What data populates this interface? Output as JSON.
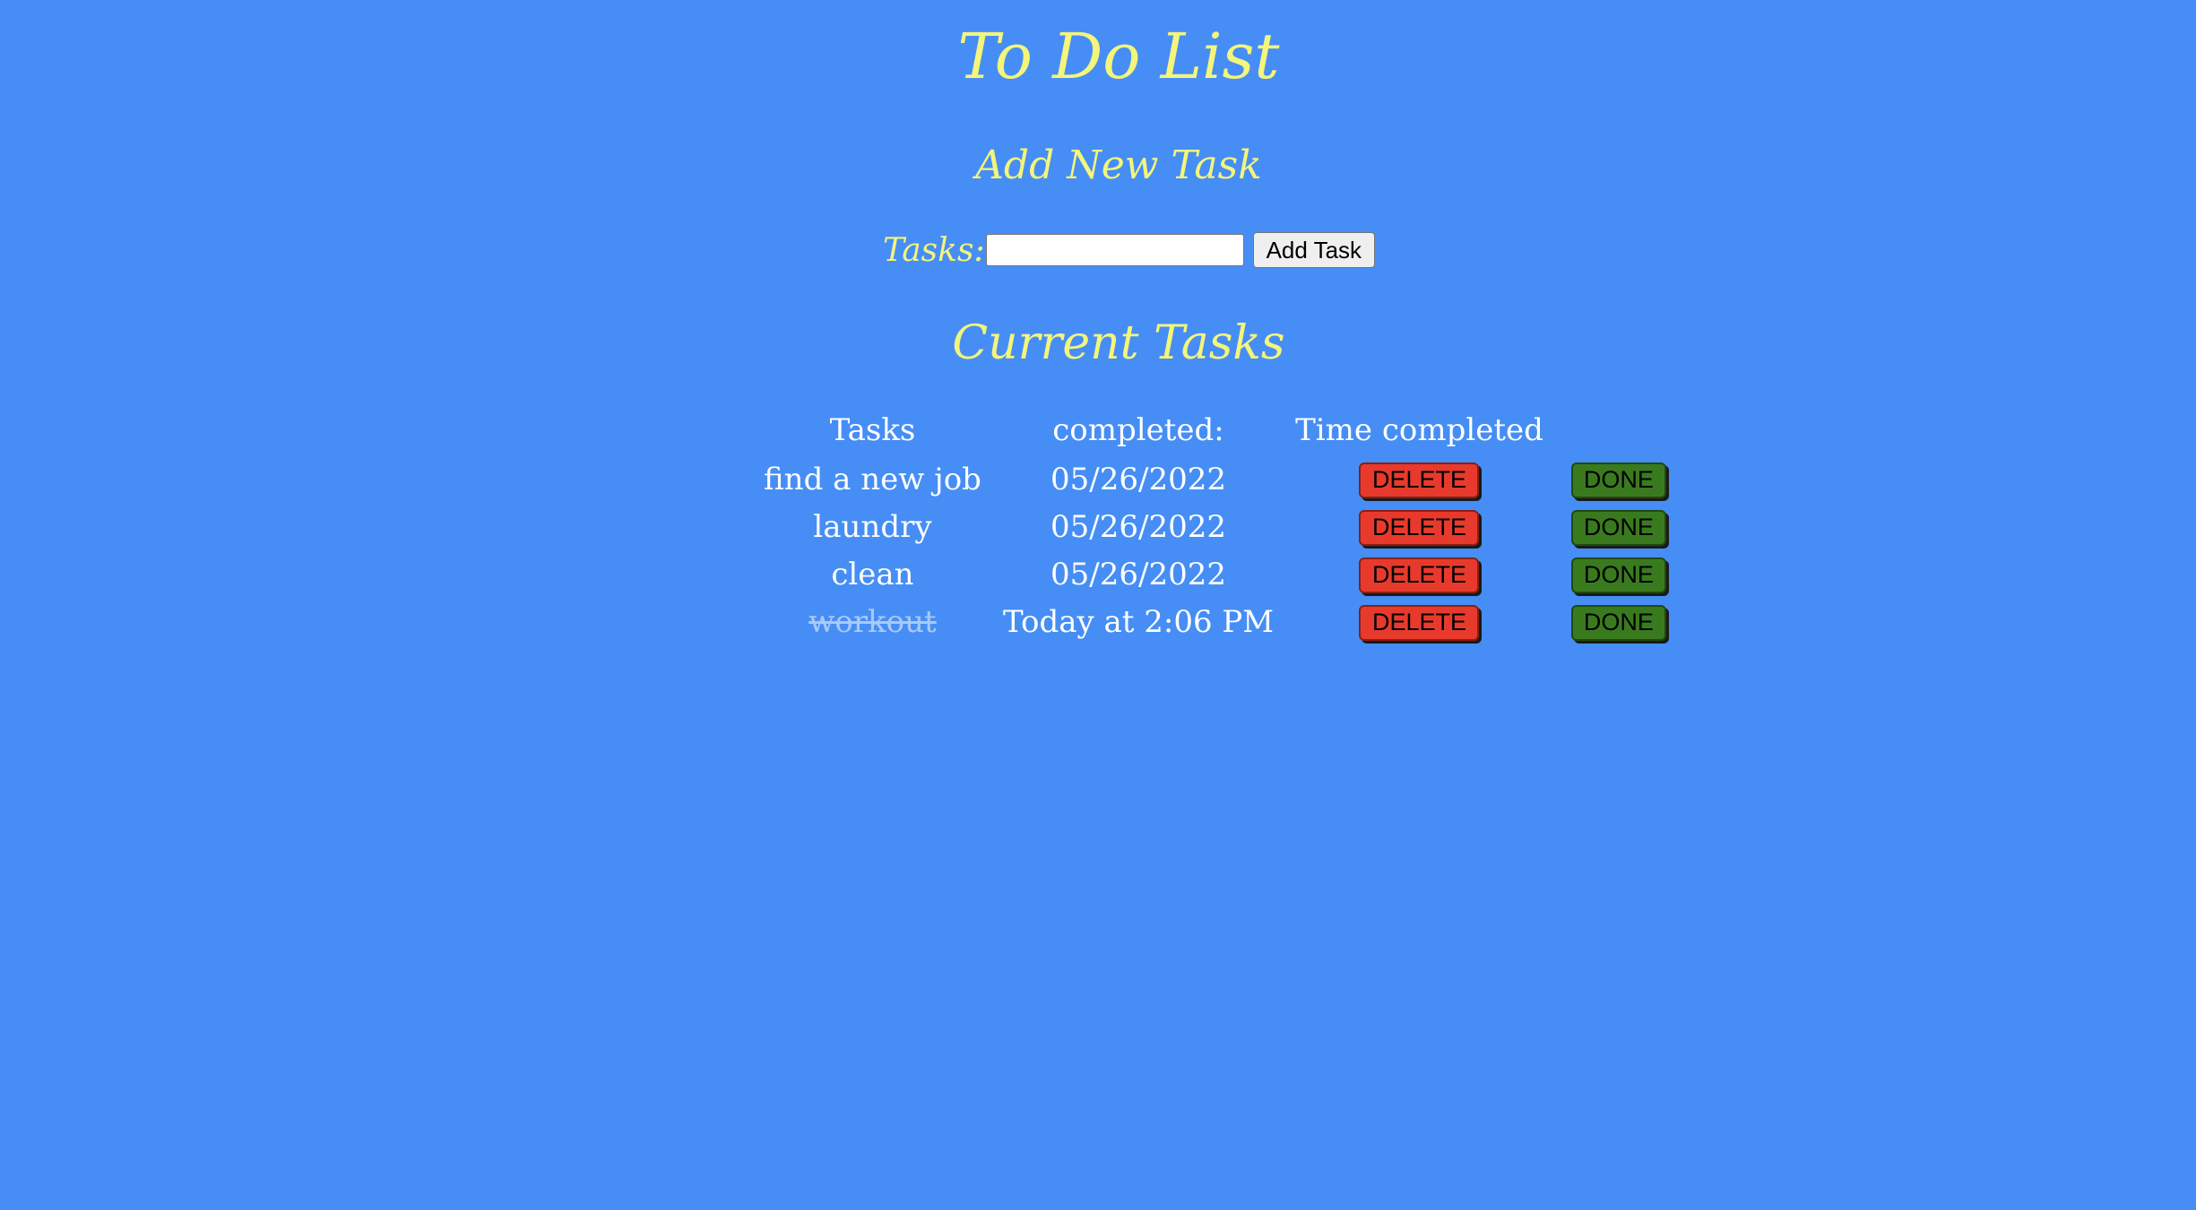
{
  "header": {
    "title": "To Do List"
  },
  "add_section": {
    "title": "Add New Task",
    "label": "Tasks:",
    "input_value": "",
    "button_label": "Add Task"
  },
  "current_section": {
    "title": "Current Tasks",
    "columns": [
      "Tasks",
      "completed:",
      "Time completed",
      ""
    ],
    "rows": [
      {
        "task": "find a new job",
        "completed": "05/26/2022",
        "is_done": false,
        "delete_label": "DELETE",
        "done_label": "DONE"
      },
      {
        "task": "laundry",
        "completed": "05/26/2022",
        "is_done": false,
        "delete_label": "DELETE",
        "done_label": "DONE"
      },
      {
        "task": "clean",
        "completed": "05/26/2022",
        "is_done": false,
        "delete_label": "DELETE",
        "done_label": "DONE"
      },
      {
        "task": "workout",
        "completed": "Today at 2:06 PM",
        "is_done": true,
        "delete_label": "DELETE",
        "done_label": "DONE"
      }
    ]
  },
  "colors": {
    "background": "#468ef5",
    "title_text": "#f4f57a",
    "table_text": "#ffffff",
    "delete_button": "#e83a2c",
    "done_button": "#3a7a1f",
    "completed_task_text": "#aac9f7"
  }
}
